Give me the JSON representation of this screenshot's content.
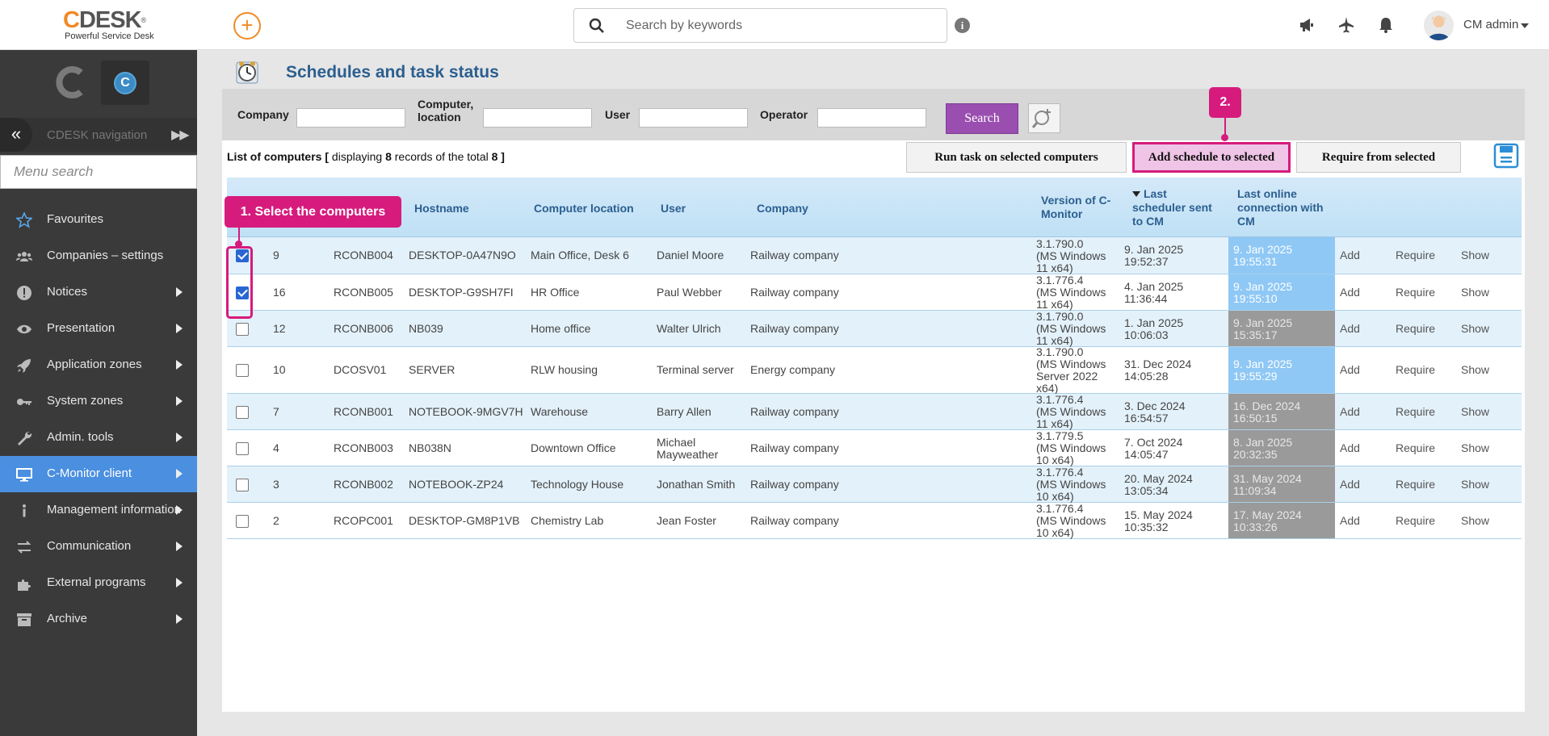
{
  "app": {
    "logo_text": "CDESK",
    "logo_tagline": "Powerful Service Desk",
    "search_placeholder": "Search by keywords",
    "user_name": "CM admin"
  },
  "sidebar": {
    "nav_label": "CDESK navigation",
    "menu_search_placeholder": "Menu search",
    "items": [
      {
        "label": "Favourites",
        "icon": "star-icon",
        "arrow": false,
        "active": false
      },
      {
        "label": "Companies – settings",
        "icon": "users-icon",
        "arrow": false,
        "active": false
      },
      {
        "label": "Notices",
        "icon": "alert-icon",
        "arrow": true,
        "active": false
      },
      {
        "label": "Presentation",
        "icon": "eye-icon",
        "arrow": true,
        "active": false
      },
      {
        "label": "Application zones",
        "icon": "rocket-icon",
        "arrow": true,
        "active": false
      },
      {
        "label": "System zones",
        "icon": "key-icon",
        "arrow": true,
        "active": false
      },
      {
        "label": "Admin. tools",
        "icon": "wrench-icon",
        "arrow": true,
        "active": false
      },
      {
        "label": "C-Monitor client",
        "icon": "monitor-icon",
        "arrow": true,
        "active": true
      },
      {
        "label": "Management information",
        "icon": "info-icon",
        "arrow": true,
        "active": false
      },
      {
        "label": "Communication",
        "icon": "exchange-icon",
        "arrow": true,
        "active": false
      },
      {
        "label": "External programs",
        "icon": "puzzle-icon",
        "arrow": true,
        "active": false
      },
      {
        "label": "Archive",
        "icon": "archive-icon",
        "arrow": true,
        "active": false
      }
    ]
  },
  "page": {
    "title": "Schedules and task status"
  },
  "filters": {
    "company_label": "Company",
    "computer_label_1": "Computer,",
    "computer_label_2": "location",
    "user_label": "User",
    "operator_label": "Operator",
    "company_value": "",
    "computer_value": "",
    "user_value": "",
    "operator_value": "",
    "search_button": "Search"
  },
  "list": {
    "prefix": "List of computers",
    "bracket_open": "[",
    "displaying": "displaying",
    "shown": "8",
    "middle": "records of the total",
    "total": "8",
    "bracket_close": "]"
  },
  "actions": {
    "run_task": "Run task on selected computers",
    "add_schedule": "Add schedule to selected",
    "require_from": "Require from selected"
  },
  "callouts": {
    "step1": "1. Select the computers",
    "step2": "2."
  },
  "table": {
    "headers": {
      "hostname": "Hostname",
      "location": "Computer location",
      "user": "User",
      "company": "Company",
      "version_1": "Version of C-",
      "version_2": "Monitor",
      "sched_1": "Last",
      "sched_2": "scheduler sent",
      "sched_3": "to CM",
      "online_1": "Last online",
      "online_2": "connection with",
      "online_3": "CM"
    },
    "rows": [
      {
        "checked": true,
        "id": "9",
        "code": "RCONB004",
        "hostname": "DESKTOP-0A47N9O",
        "location": "Main Office, Desk 6",
        "user": "Daniel Moore",
        "company": "Railway company",
        "version": [
          "3.1.790.0",
          "(MS Windows",
          "11 x64)"
        ],
        "sched": [
          "9. Jan 2025",
          "19:52:37"
        ],
        "online": [
          "9. Jan 2025",
          "19:55:31"
        ],
        "online_state": "recent",
        "add": "Add",
        "require": "Require",
        "show": "Show"
      },
      {
        "checked": true,
        "id": "16",
        "code": "RCONB005",
        "hostname": "DESKTOP-G9SH7FI",
        "location": "HR Office",
        "user": "Paul Webber",
        "company": "Railway company",
        "version": [
          "3.1.776.4",
          "(MS Windows",
          "11 x64)"
        ],
        "sched": [
          "4. Jan 2025",
          "11:36:44"
        ],
        "online": [
          "9. Jan 2025",
          "19:55:10"
        ],
        "online_state": "recent",
        "add": "Add",
        "require": "Require",
        "show": "Show"
      },
      {
        "checked": false,
        "id": "12",
        "code": "RCONB006",
        "hostname": "NB039",
        "location": "Home office",
        "user": "Walter Ulrich",
        "company": "Railway company",
        "version": [
          "3.1.790.0",
          "(MS Windows",
          "11 x64)"
        ],
        "sched": [
          "1. Jan 2025",
          "10:06:03"
        ],
        "online": [
          "9. Jan 2025",
          "15:35:17"
        ],
        "online_state": "old",
        "add": "Add",
        "require": "Require",
        "show": "Show"
      },
      {
        "checked": false,
        "id": "10",
        "code": "DCOSV01",
        "hostname": "SERVER",
        "location": "RLW housing",
        "user": "Terminal server",
        "company": "Energy company",
        "version": [
          "3.1.790.0",
          "(MS Windows",
          "Server 2022",
          "x64)"
        ],
        "sched": [
          "31. Dec 2024",
          "14:05:28"
        ],
        "online": [
          "9. Jan 2025",
          "19:55:29"
        ],
        "online_state": "recent",
        "add": "Add",
        "require": "Require",
        "show": "Show"
      },
      {
        "checked": false,
        "id": "7",
        "code": "RCONB001",
        "hostname": "NOTEBOOK-9MGV7H",
        "location": "Warehouse",
        "user": "Barry Allen",
        "company": "Railway company",
        "version": [
          "3.1.776.4",
          "(MS Windows",
          "11 x64)"
        ],
        "sched": [
          "3. Dec 2024",
          "16:54:57"
        ],
        "online": [
          "16. Dec 2024",
          "16:50:15"
        ],
        "online_state": "old",
        "add": "Add",
        "require": "Require",
        "show": "Show"
      },
      {
        "checked": false,
        "id": "4",
        "code": "RCONB003",
        "hostname": "NB038N",
        "location": "Downtown Office",
        "user": "Michael Mayweather",
        "user_lines": [
          "Michael",
          "Mayweather"
        ],
        "company": "Railway company",
        "version": [
          "3.1.779.5",
          "(MS Windows",
          "10 x64)"
        ],
        "sched": [
          "7. Oct 2024",
          "14:05:47"
        ],
        "online": [
          "8. Jan 2025",
          "20:32:35"
        ],
        "online_state": "old",
        "add": "Add",
        "require": "Require",
        "show": "Show"
      },
      {
        "checked": false,
        "id": "3",
        "code": "RCONB002",
        "hostname": "NOTEBOOK-ZP24",
        "location": "Technology House",
        "user": "Jonathan Smith",
        "company": "Railway company",
        "version": [
          "3.1.776.4",
          "(MS Windows",
          "10 x64)"
        ],
        "sched": [
          "20. May 2024",
          "13:05:34"
        ],
        "online": [
          "31. May 2024",
          "11:09:34"
        ],
        "online_state": "old",
        "add": "Add",
        "require": "Require",
        "show": "Show"
      },
      {
        "checked": false,
        "id": "2",
        "code": "RCOPC001",
        "hostname": "DESKTOP-GM8P1VB",
        "location": "Chemistry Lab",
        "user": "Jean Foster",
        "company": "Railway company",
        "version": [
          "3.1.776.4",
          "(MS Windows",
          "10 x64)"
        ],
        "sched": [
          "15. May 2024",
          "10:35:32"
        ],
        "online": [
          "17. May 2024",
          "10:33:26"
        ],
        "online_state": "old",
        "add": "Add",
        "require": "Require",
        "show": "Show"
      }
    ]
  },
  "colors": {
    "accent_orange": "#f08a24",
    "title_blue": "#2b5f8f",
    "active_blue": "#4a8fe0",
    "callout_pink": "#d61b7d",
    "search_purple": "#9a4fb0"
  }
}
